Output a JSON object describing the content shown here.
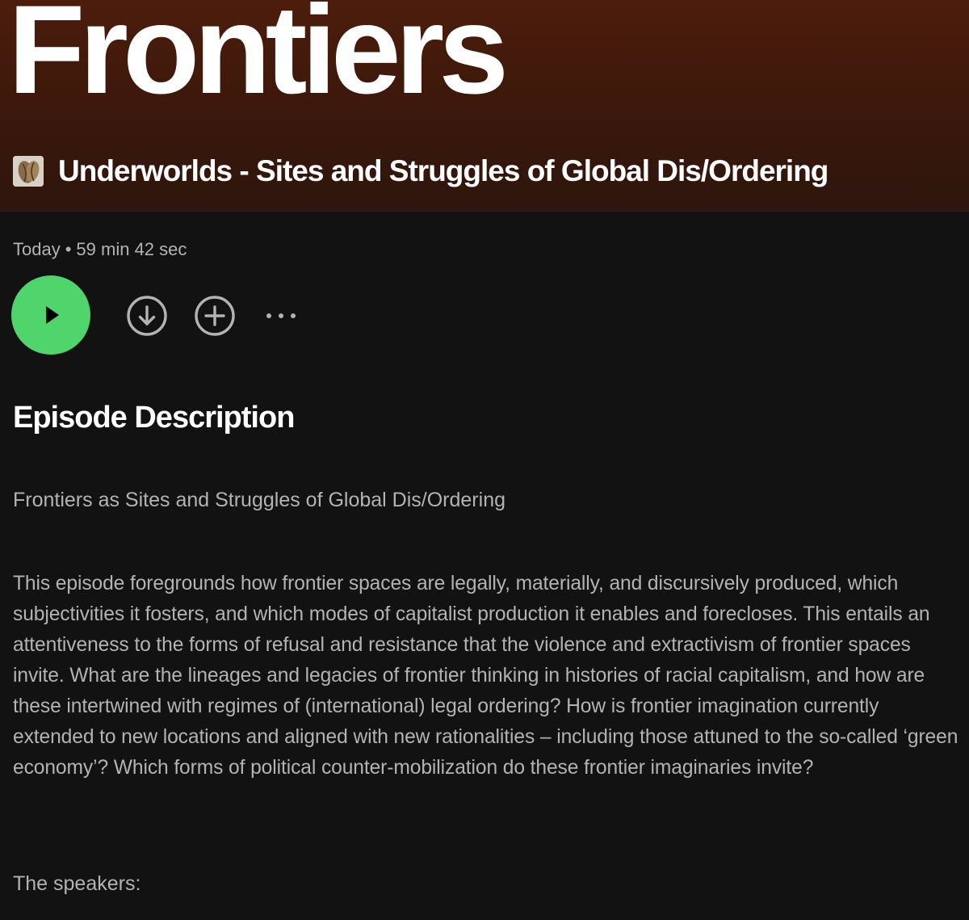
{
  "episode": {
    "title": "Frontiers",
    "show_name": "Underworlds - Sites and Struggles of Global Dis/Ordering",
    "date": "Today",
    "separator": "•",
    "duration": "59 min 42 sec"
  },
  "controls": {
    "play_icon": "play-icon",
    "download_icon": "download-circle-icon",
    "add_icon": "plus-circle-icon",
    "more_icon": "more-horizontal-icon"
  },
  "description": {
    "heading": "Episode Description",
    "subtitle": "Frontiers as Sites and Struggles of Global Dis/Ordering",
    "body": "This episode foregrounds how frontier spaces are legally, materially, and discursively produced, which subjectivities it fosters, and which modes of capitalist production it enables and forecloses. This entails an attentiveness to the forms of refusal and resistance that the violence and extractivism of frontier spaces invite. What are the lineages and legacies of frontier thinking in histories of racial capitalism, and how are these intertwined with regimes of (international) legal ordering? How is frontier imagination currently extended to new locations and aligned with new rationalities – including those attuned to the so-called ‘green economy’? Which forms of political counter-mobilization do these frontier imaginaries invite?",
    "speakers_label": "The speakers:"
  },
  "colors": {
    "background": "#121212",
    "hero_gradient_top": "#4d1d0c",
    "accent_green": "#4fd56c",
    "text_primary": "#ffffff",
    "text_secondary": "#b3b3b3"
  }
}
